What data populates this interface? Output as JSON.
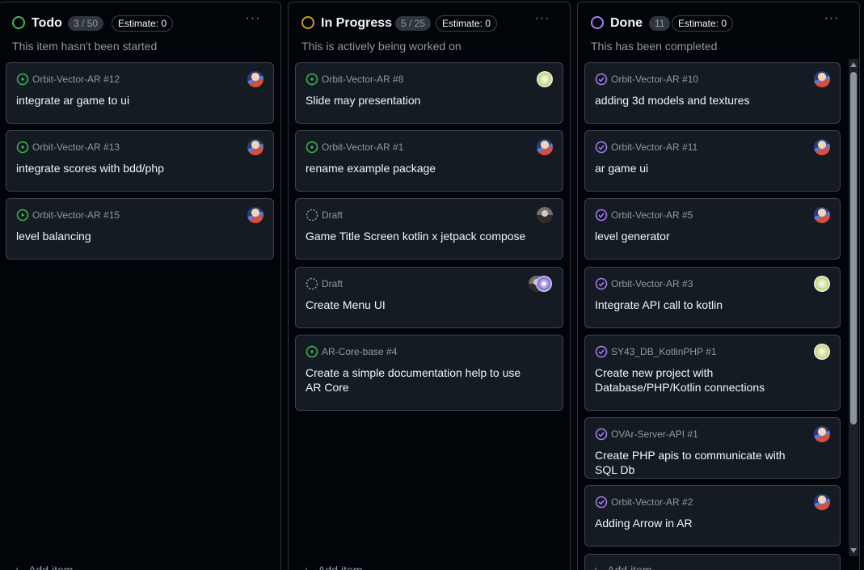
{
  "columns": {
    "todo": {
      "title": "Todo",
      "count": "3 / 50",
      "estimate": "Estimate: 0",
      "description": "This item hasn't been started",
      "status_color": "#3fb950",
      "add_item": "Add item",
      "cards": [
        {
          "ref": "Orbit-Vector-AR #12",
          "title": "integrate ar game to ui"
        },
        {
          "ref": "Orbit-Vector-AR #13",
          "title": "integrate scores with bdd/php"
        },
        {
          "ref": "Orbit-Vector-AR #15",
          "title": "level balancing"
        }
      ]
    },
    "in_progress": {
      "title": "In Progress",
      "count": "5 / 25",
      "estimate": "Estimate: 0",
      "description": "This is actively being worked on",
      "status_color": "#d29922",
      "add_item": "Add item",
      "cards": [
        {
          "ref": "Orbit-Vector-AR #8",
          "title": "Slide may presentation"
        },
        {
          "ref": "Orbit-Vector-AR #1",
          "title": "rename example package"
        },
        {
          "ref": "Draft",
          "title": "Game Title Screen kotlin x jetpack compose"
        },
        {
          "ref": "Draft",
          "title": "Create Menu UI"
        },
        {
          "ref": "AR-Core-base #4",
          "title": "Create a simple documentation help to use AR Core"
        }
      ]
    },
    "done": {
      "title": "Done",
      "count": "11",
      "estimate": "Estimate: 0",
      "description": "This has been completed",
      "status_color": "#ab7df8",
      "add_item": "Add item",
      "cards": [
        {
          "ref": "Orbit-Vector-AR #10",
          "title": "adding 3d models and textures"
        },
        {
          "ref": "Orbit-Vector-AR #11",
          "title": "ar game ui"
        },
        {
          "ref": "Orbit-Vector-AR #5",
          "title": "level generator"
        },
        {
          "ref": "Orbit-Vector-AR #3",
          "title": "Integrate API call to kotlin"
        },
        {
          "ref": "SY43_DB_KotlinPHP #1",
          "title": "Create new project with Database/PHP/Kotlin connections"
        },
        {
          "ref": "OVAr-Server-API #1",
          "title": "Create PHP apis to communicate with SQL Db"
        },
        {
          "ref": "Orbit-Vector-AR #2",
          "title": "Adding Arrow in AR"
        }
      ]
    }
  },
  "more_menu": "···"
}
